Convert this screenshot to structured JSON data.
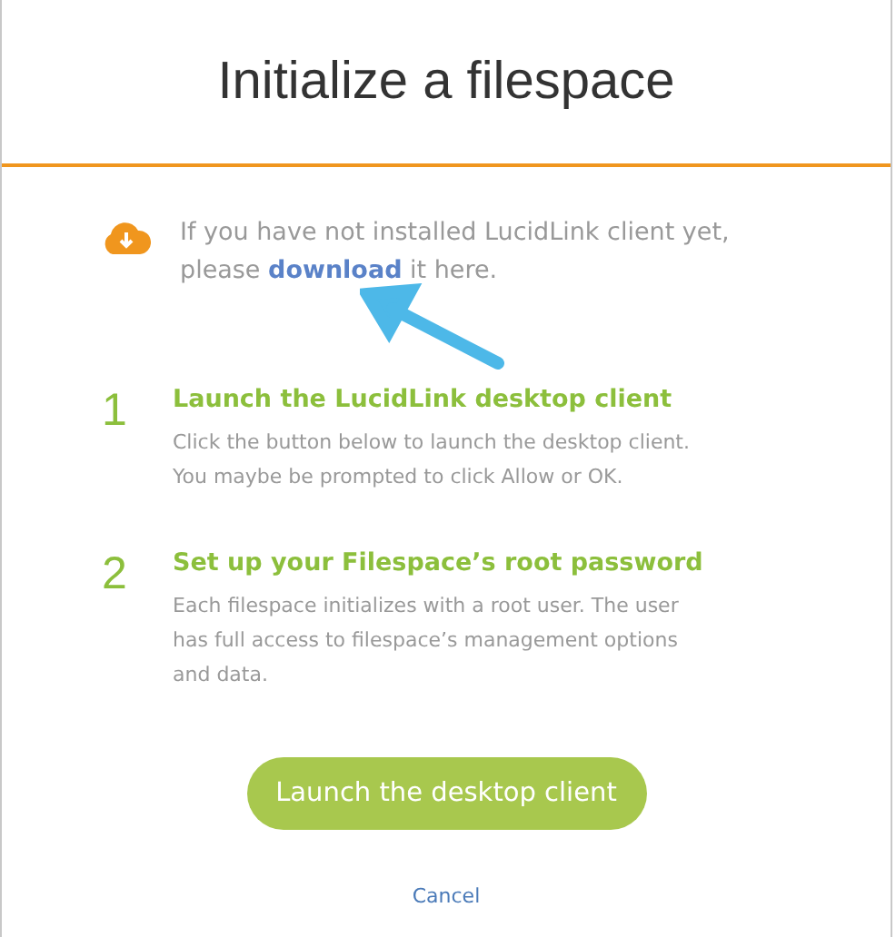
{
  "dialog": {
    "title": "Initialize a filespace"
  },
  "notice": {
    "before": "If you have not installed LucidLink client yet, please ",
    "link": "download",
    "after": " it here."
  },
  "steps": [
    {
      "number": "1",
      "title": "Launch the LucidLink desktop client",
      "description": "Click the button below to launch the desktop client. You maybe be prompted to click Allow or OK."
    },
    {
      "number": "2",
      "title": "Set up your Filespace’s root password",
      "description": "Each filespace initializes with a root user. The user has full access to filespace’s management options and data."
    }
  ],
  "primary_button": "Launch the desktop client",
  "cancel_link": "Cancel"
}
